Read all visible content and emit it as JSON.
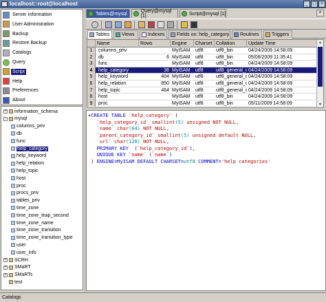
{
  "window": {
    "title": "localhost::root@localhost"
  },
  "nav": {
    "items": [
      {
        "label": "Server Information",
        "icon": "server-info-icon"
      },
      {
        "label": "User Administration",
        "icon": "users-icon"
      },
      {
        "label": "Backup",
        "icon": "backup-icon"
      },
      {
        "label": "Restore Backup",
        "icon": "restore-icon"
      },
      {
        "label": "Catalogs",
        "icon": "catalogs-icon"
      },
      {
        "label": "Query",
        "icon": "query-icon"
      },
      {
        "label": "Script",
        "icon": "script-icon",
        "selected": true
      },
      {
        "label": "Help",
        "icon": "help-icon"
      },
      {
        "label": "Preferences",
        "icon": "preferences-icon"
      },
      {
        "label": "About",
        "icon": "about-icon"
      }
    ]
  },
  "tree": {
    "items": [
      {
        "label": "information_schema",
        "level": 0,
        "toggle": "+",
        "type": "db"
      },
      {
        "label": "mysql",
        "level": 0,
        "toggle": "-",
        "type": "db"
      },
      {
        "label": "columns_priv",
        "level": 1,
        "type": "table"
      },
      {
        "label": "db",
        "level": 1,
        "type": "table"
      },
      {
        "label": "func",
        "level": 1,
        "type": "table"
      },
      {
        "label": "help_category",
        "level": 1,
        "type": "table",
        "selected": true
      },
      {
        "label": "help_keyword",
        "level": 1,
        "type": "table"
      },
      {
        "label": "help_relation",
        "level": 1,
        "type": "table"
      },
      {
        "label": "help_topic",
        "level": 1,
        "type": "table"
      },
      {
        "label": "host",
        "level": 1,
        "type": "table"
      },
      {
        "label": "proc",
        "level": 1,
        "type": "table"
      },
      {
        "label": "procs_priv",
        "level": 1,
        "type": "table"
      },
      {
        "label": "tables_priv",
        "level": 1,
        "type": "table"
      },
      {
        "label": "time_zone",
        "level": 1,
        "type": "table"
      },
      {
        "label": "time_zone_leap_second",
        "level": 1,
        "type": "table"
      },
      {
        "label": "time_zone_name",
        "level": 1,
        "type": "table"
      },
      {
        "label": "time_zone_transition",
        "level": 1,
        "type": "table"
      },
      {
        "label": "time_zone_transition_type",
        "level": 1,
        "type": "table"
      },
      {
        "label": "user",
        "level": 1,
        "type": "table"
      },
      {
        "label": "user_info",
        "level": 1,
        "type": "table"
      },
      {
        "label": "SCRH",
        "level": 0,
        "toggle": "+",
        "type": "db"
      },
      {
        "label": "SMaRT",
        "level": 0,
        "toggle": "+",
        "type": "db"
      },
      {
        "label": "SMaRTs",
        "level": 0,
        "toggle": "+",
        "type": "db"
      },
      {
        "label": "test",
        "level": 0,
        "type": "db"
      }
    ]
  },
  "doc_tabs": [
    {
      "label": "Tables@mysql",
      "selected": true
    },
    {
      "label": "Query@mysql [1]"
    },
    {
      "label": "Script@mysql [1]"
    }
  ],
  "close_label": "×",
  "sub_tabs": [
    {
      "label": "Tables",
      "selected": true
    },
    {
      "label": "Views"
    },
    {
      "label": "Indexes"
    },
    {
      "label": "Fields on: help_category"
    },
    {
      "label": "Routines"
    },
    {
      "label": "Triggers"
    }
  ],
  "grid": {
    "columns": [
      "Name",
      "Rows",
      "Engine",
      "Charset",
      "Collation",
      "Update Time"
    ],
    "rows": [
      {
        "n": "1",
        "name": "columns_priv",
        "rows": "",
        "engine": "MyISAM",
        "charset": "utf8",
        "collation": "utf8_bin",
        "update": "04/24/2009 14:58:09"
      },
      {
        "n": "2",
        "name": "db",
        "rows": "6",
        "engine": "MyISAM",
        "charset": "utf8",
        "collation": "utf8_bin",
        "update": "05/06/2009 11:35:41"
      },
      {
        "n": "3",
        "name": "func",
        "rows": "",
        "engine": "MyISAM",
        "charset": "utf8",
        "collation": "utf8_bin",
        "update": "04/24/2009 14:58:09"
      },
      {
        "n": "4",
        "name": "help_category",
        "rows": "36",
        "engine": "MyISAM",
        "charset": "utf8",
        "collation": "utf8_general_ci",
        "update": "04/24/2009 14:58:09",
        "selected": true
      },
      {
        "n": "5",
        "name": "help_keyword",
        "rows": "404",
        "engine": "MyISAM",
        "charset": "utf8",
        "collation": "utf8_general_ci",
        "update": "04/24/2009 14:58:09"
      },
      {
        "n": "6",
        "name": "help_relation",
        "rows": "850",
        "engine": "MyISAM",
        "charset": "utf8",
        "collation": "utf8_general_ci",
        "update": "04/24/2009 14:58:09"
      },
      {
        "n": "7",
        "name": "help_topic",
        "rows": "464",
        "engine": "MyISAM",
        "charset": "utf8",
        "collation": "utf8_general_ci",
        "update": "04/24/2009 14:58:09"
      },
      {
        "n": "8",
        "name": "host",
        "rows": "",
        "engine": "MyISAM",
        "charset": "utf8",
        "collation": "utf8_bin",
        "update": "04/24/2009 14:58:09"
      },
      {
        "n": "9",
        "name": "proc",
        "rows": "",
        "engine": "MyISAM",
        "charset": "utf8",
        "collation": "utf8_bin",
        "update": "05/11/2009 14:58:09"
      }
    ]
  },
  "ddl": {
    "l1a": "CREATE TABLE ",
    "l1b": "`help_category`",
    "l1c": " (",
    "l2a": "`help_category_id`",
    "l2b": " smallint",
    "l2c": "(5)",
    "l2d": " unsigned NOT NULL,",
    "l3a": "`name`",
    "l3b": " char",
    "l3c": "(64)",
    "l3d": " NOT NULL,",
    "l4a": "`parent_category_id`",
    "l4b": " smallint",
    "l4c": "(5)",
    "l4d": " unsigned default NULL,",
    "l5a": "`url`",
    "l5b": " char",
    "l5c": "(128)",
    "l5d": " NOT NULL,",
    "l6a": "PRIMARY KEY",
    "l6b": "  (",
    "l6c": "`help_category_id`",
    "l6d": "),",
    "l7a": "UNIQUE KEY ",
    "l7b": "`name`",
    "l7c": " (",
    "l7d": "`name`",
    "l7e": ")",
    "l8a": ") ",
    "l8b": "ENGINE=MyISAM DEFAULT CHARSET=",
    "l8c": "utf8",
    "l8d": " COMMENT=",
    "l8e": "'help categories'"
  },
  "status": {
    "text": "Catalogs"
  },
  "colors": {
    "selection": "#1a1a7a",
    "keyword": "#0000c8",
    "identifier": "#b00000",
    "type_value": "#00808a"
  }
}
